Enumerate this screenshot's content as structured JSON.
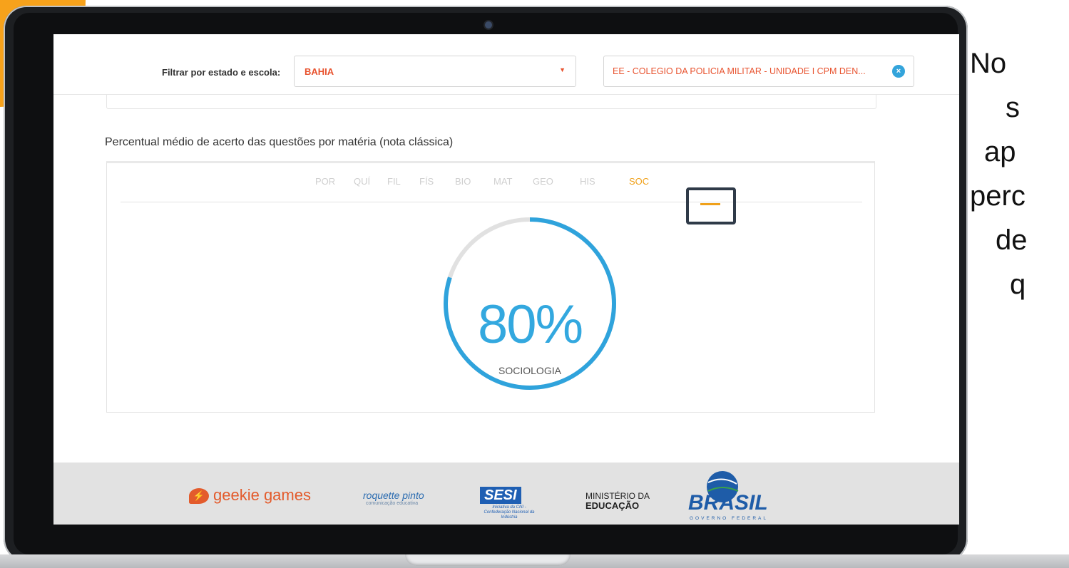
{
  "filter": {
    "label": "Filtrar por estado e escola:",
    "state_value": "BAHIA",
    "school_value": "EE - COLEGIO DA POLICIA MILITAR - UNIDADE I CPM DEN...",
    "clear_icon": "×"
  },
  "section": {
    "title": "Percentual médio de acerto das questões por matéria (nota clássica)"
  },
  "tabs": [
    {
      "label": "POR"
    },
    {
      "label": "QUÍ"
    },
    {
      "label": "FIL"
    },
    {
      "label": "FÍS"
    },
    {
      "label": "BIO"
    },
    {
      "label": "MAT"
    },
    {
      "label": "GEO"
    },
    {
      "label": "HIS"
    },
    {
      "label": "SOC",
      "active": true
    }
  ],
  "result": {
    "percent_text": "80%",
    "percent_value": 80,
    "subject": "SOCIOLOGIA",
    "ring_color": "#2fa3dc",
    "track_color": "#e1e1e1"
  },
  "footer": {
    "geekie": "geekie games",
    "roquette": "roquette pinto",
    "roquette_sub": "comunicação educativa",
    "sesi": "SESI",
    "sesi_sub": "Iniciativa da CNI - Confederação Nacional da Indústria",
    "mec_line1": "MINISTÉRIO DA",
    "mec_line2": "EDUCAÇÃO",
    "brasil": "BRASIL",
    "brasil_sub": "GOVERNO FEDERAL"
  },
  "side_text": {
    "lines": [
      "No",
      "s",
      "ap",
      "perc",
      "de",
      "q"
    ]
  },
  "colors": {
    "accent_orange": "#f0a11a",
    "select_text": "#e8532f",
    "highlight_box": "#2f3a48"
  }
}
